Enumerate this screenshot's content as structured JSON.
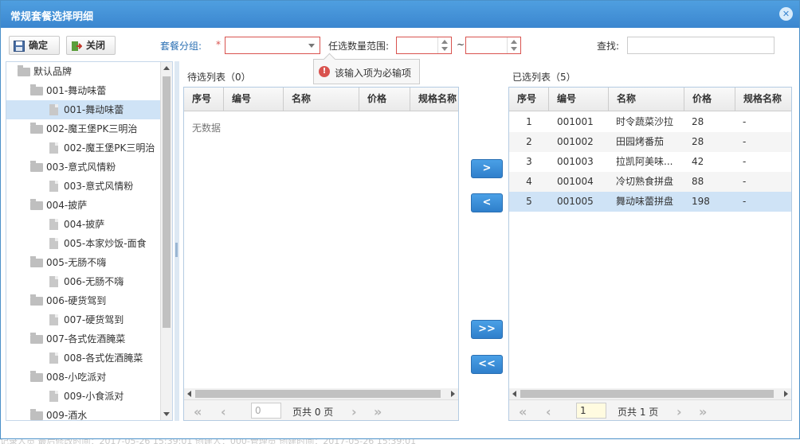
{
  "window": {
    "title": "常规套餐选择明细",
    "close_glyph": "✕"
  },
  "toolbar": {
    "confirm_label": "确定",
    "close_label": "关闭",
    "group_label": "套餐分组:",
    "required_mark": "*",
    "range_label": "任选数量范围:",
    "range_sep": "~",
    "search_label": "查找:"
  },
  "tooltip": {
    "icon": "!",
    "message": "该输入项为必输项"
  },
  "tree": {
    "items": [
      {
        "label": "默认品牌",
        "level": 0,
        "kind": "folder"
      },
      {
        "label": "001-舞动味蕾",
        "level": 1,
        "kind": "folder"
      },
      {
        "label": "001-舞动味蕾",
        "level": 2,
        "kind": "file",
        "selected": true
      },
      {
        "label": "002-魔王堡PK三明治",
        "level": 1,
        "kind": "folder"
      },
      {
        "label": "002-魔王堡PK三明治",
        "level": 2,
        "kind": "file"
      },
      {
        "label": "003-意式风情粉",
        "level": 1,
        "kind": "folder"
      },
      {
        "label": "003-意式风情粉",
        "level": 2,
        "kind": "file"
      },
      {
        "label": "004-披萨",
        "level": 1,
        "kind": "folder"
      },
      {
        "label": "004-披萨",
        "level": 2,
        "kind": "file"
      },
      {
        "label": "005-本家炒饭-面食",
        "level": 2,
        "kind": "file"
      },
      {
        "label": "005-无肠不嗨",
        "level": 1,
        "kind": "folder"
      },
      {
        "label": "006-无肠不嗨",
        "level": 2,
        "kind": "file"
      },
      {
        "label": "006-硬货驾到",
        "level": 1,
        "kind": "folder"
      },
      {
        "label": "007-硬货驾到",
        "level": 2,
        "kind": "file"
      },
      {
        "label": "007-各式佐酒腌菜",
        "level": 1,
        "kind": "folder"
      },
      {
        "label": "008-各式佐酒腌菜",
        "level": 2,
        "kind": "file"
      },
      {
        "label": "008-小吃派对",
        "level": 1,
        "kind": "folder"
      },
      {
        "label": "009-小食派对",
        "level": 2,
        "kind": "file"
      },
      {
        "label": "009-酒水",
        "level": 1,
        "kind": "folder"
      }
    ]
  },
  "left_grid": {
    "title": "待选列表（0）",
    "columns": [
      "序号",
      "编号",
      "名称",
      "价格",
      "规格名称"
    ],
    "empty_text": "无数据",
    "pager": {
      "page_value": "0",
      "page_text": "页共 0 页"
    }
  },
  "right_grid": {
    "title": "已选列表（5）",
    "columns": [
      "序号",
      "编号",
      "名称",
      "价格",
      "规格名称"
    ],
    "rows": [
      {
        "no": "1",
        "code": "001001",
        "name": "时令蔬菜沙拉",
        "price": "28",
        "spec": "-"
      },
      {
        "no": "2",
        "code": "001002",
        "name": "田园烤番茄",
        "price": "28",
        "spec": "-"
      },
      {
        "no": "3",
        "code": "001003",
        "name": "拉凯阿美味...",
        "price": "42",
        "spec": "-"
      },
      {
        "no": "4",
        "code": "001004",
        "name": "冷切熟食拼盘",
        "price": "88",
        "spec": "-"
      },
      {
        "no": "5",
        "code": "001005",
        "name": "舞动味蕾拼盘",
        "price": "198",
        "spec": "-",
        "selected": true
      }
    ],
    "pager": {
      "page_value": "1",
      "page_text": "页共 1 页"
    }
  },
  "move_buttons": {
    "add": ">",
    "remove": "<",
    "add_all": ">>",
    "remove_all": "<<"
  },
  "pager_glyphs": {
    "first": "«",
    "prev": "‹",
    "next": "›",
    "last": "»"
  },
  "background_text": "记录人员    最后修改时间：2017-05-26 15:39:01          创建人：000-管理员          创建时间：2017-05-26 15:39:01"
}
